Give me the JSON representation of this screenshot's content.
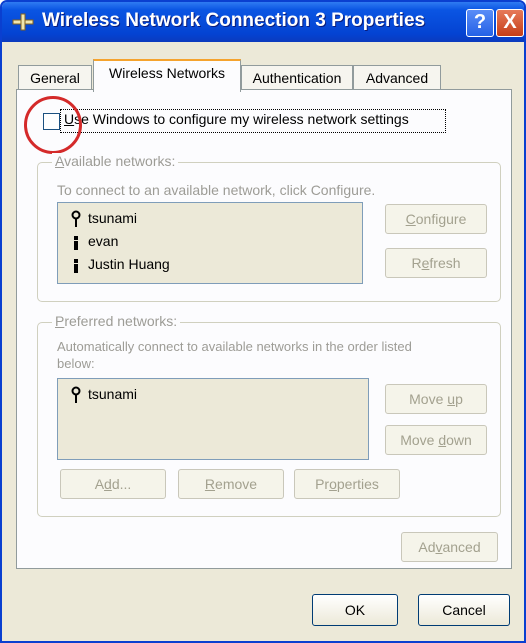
{
  "window": {
    "title": "Wireless Network Connection 3 Properties",
    "help_label": "?",
    "close_label": "X"
  },
  "tabs": [
    {
      "label": "General"
    },
    {
      "label": "Wireless Networks"
    },
    {
      "label": "Authentication"
    },
    {
      "label": "Advanced"
    }
  ],
  "checkbox": {
    "label_first": "U",
    "label_rest": "se Windows to configure my wireless network settings",
    "checked": false
  },
  "available": {
    "group_first": "A",
    "group_rest": "vailable networks:",
    "description": "To connect to an available network, click Configure.",
    "networks": [
      "tsunami",
      "evan",
      "Justin Huang"
    ],
    "configure_first": "C",
    "configure_rest": "onfigure",
    "refresh_pre": "R",
    "refresh_u": "e",
    "refresh_rest": "fresh"
  },
  "preferred": {
    "group_first": "P",
    "group_rest": "referred networks:",
    "description_line1": "Automatically connect to available networks in the order listed",
    "description_line2": "below:",
    "networks": [
      "tsunami"
    ],
    "move_up_pre": "Move ",
    "move_up_u": "u",
    "move_up_rest": "p",
    "move_down_pre": "Move ",
    "move_down_u": "d",
    "move_down_rest": "own",
    "add_pre": "A",
    "add_u": "d",
    "add_rest": "d...",
    "remove_first": "R",
    "remove_rest": "emove",
    "properties_pre": "Pr",
    "properties_u": "o",
    "properties_rest": "perties"
  },
  "advanced_button": {
    "pre": "Ad",
    "u": "v",
    "rest": "anced"
  },
  "footer": {
    "ok_label": "OK",
    "cancel_label": "Cancel"
  }
}
